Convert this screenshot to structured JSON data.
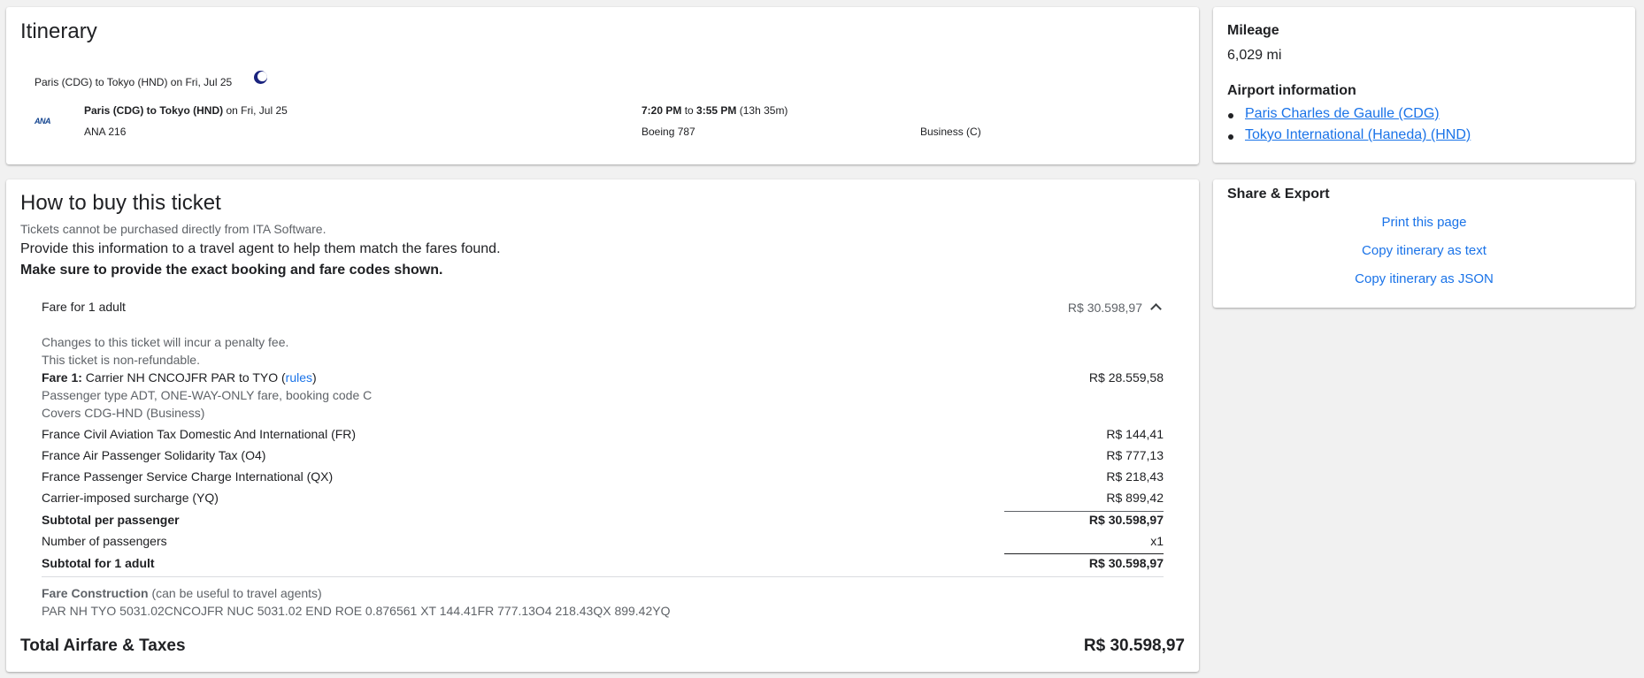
{
  "itinerary": {
    "title": "Itinerary",
    "header_route": "Paris (CDG) to Tokyo (HND) on Fri, Jul 25",
    "segment": {
      "airline_logo": "ANA",
      "route": "Paris (CDG) to Tokyo (HND)",
      "date_suffix": " on Fri, Jul 25",
      "flight": "ANA 216",
      "depart": "7:20 PM",
      "to": " to ",
      "arrive": "3:55 PM",
      "duration": " (13h 35m)",
      "aircraft": "Boeing 787",
      "cabin": "Business (C)"
    },
    "overnight_icon": "moon-icon"
  },
  "mileage": {
    "title": "Mileage",
    "value": "6,029 mi",
    "airport_title": "Airport information",
    "airports": [
      "Paris Charles de Gaulle (CDG)",
      "Tokyo International (Haneda) (HND)"
    ]
  },
  "share": {
    "title": "Share & Export",
    "print": "Print this page",
    "copy_text": "Copy itinerary as text",
    "copy_json": "Copy itinerary as JSON"
  },
  "buy": {
    "title": "How to buy this ticket",
    "note": "Tickets cannot be purchased directly from ITA Software.",
    "instruction": "Provide this information to a travel agent to help them match the fares found.",
    "bold_instruction": "Make sure to provide the exact booking and fare codes shown.",
    "fare_header": "Fare for 1 adult",
    "fare_header_price": "R$ 30.598,97",
    "penalty": "Changes to this ticket will incur a penalty fee.",
    "nonrefundable": "This ticket is non-refundable.",
    "fare1_label": "Fare 1:",
    "fare1_text": " Carrier NH CNCOJFR PAR to TYO (",
    "fare1_rules": "rules",
    "fare1_close": ")",
    "fare1_price": "R$ 28.559,58",
    "fare1_pax": "Passenger type ADT, ONE-WAY-ONLY fare, booking code C",
    "fare1_covers": "Covers CDG-HND (Business)",
    "taxes": [
      {
        "label": "France Civil Aviation Tax Domestic And International (FR)",
        "price": "R$ 144,41"
      },
      {
        "label": "France Air Passenger Solidarity Tax (O4)",
        "price": "R$ 777,13"
      },
      {
        "label": "France Passenger Service Charge International (QX)",
        "price": "R$ 218,43"
      },
      {
        "label": "Carrier-imposed surcharge (YQ)",
        "price": "R$ 899,42"
      }
    ],
    "subtotal_label": "Subtotal per passenger",
    "subtotal_price": "R$ 30.598,97",
    "passengers_label": "Number of passengers",
    "passengers_value": "x1",
    "subtotal_adult_label": "Subtotal for 1 adult",
    "subtotal_adult_price": "R$ 30.598,97",
    "construction_label": "Fare Construction",
    "construction_note": " (can be useful to travel agents)",
    "construction_value": "PAR NH TYO 5031.02CNCOJFR NUC 5031.02 END ROE 0.876561 XT 144.41FR 777.13O4 218.43QX 899.42YQ",
    "total_label": "Total Airfare & Taxes",
    "total_price": "R$ 30.598,97"
  }
}
